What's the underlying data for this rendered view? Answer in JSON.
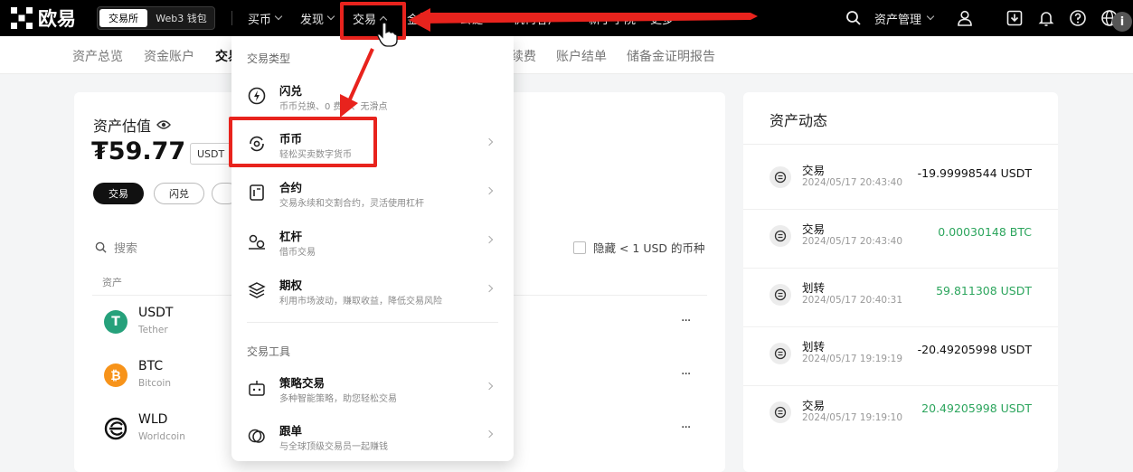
{
  "header": {
    "logo_text": "欧易",
    "tab_exchange": "交易所",
    "tab_web3": "Web3 钱包",
    "nav": [
      {
        "label": "买币"
      },
      {
        "label": "发现"
      },
      {
        "label": "交易"
      },
      {
        "label": "金融"
      },
      {
        "label": "公链"
      },
      {
        "label": "机构客户"
      },
      {
        "label": "新手学院"
      },
      {
        "label": "更多"
      }
    ],
    "asset_manage": "资产管理"
  },
  "subnav": {
    "items": [
      "资产总览",
      "资金账户",
      "交易账户",
      "续费",
      "账户结单",
      "储备金证明报告"
    ],
    "active_partial": "交易",
    "partial_visible": "续费"
  },
  "assets": {
    "valuation_title": "资产估值",
    "valuation_amount": "₮59.77",
    "currency": "USDT",
    "chips": [
      "交易",
      "闪兑"
    ],
    "search_placeholder": "搜索",
    "hide_small_label": "隐藏 < 1 USD 的币种",
    "column_asset": "资产",
    "rows": [
      {
        "symbol": "USDT",
        "name": "Tether",
        "more": "···"
      },
      {
        "symbol": "BTC",
        "name": "Bitcoin",
        "more": "···"
      },
      {
        "symbol": "WLD",
        "name": "Worldcoin",
        "more": "···"
      }
    ]
  },
  "activity": {
    "title": "资产动态",
    "rows": [
      {
        "type": "交易",
        "time": "2024/05/17 20:43:40",
        "amount": "-19.99998544 USDT",
        "positive": false
      },
      {
        "type": "交易",
        "time": "2024/05/17 20:43:40",
        "amount": "0.00030148 BTC",
        "positive": true
      },
      {
        "type": "划转",
        "time": "2024/05/17 20:40:31",
        "amount": "59.811308 USDT",
        "positive": true
      },
      {
        "type": "划转",
        "time": "2024/05/17 19:19:19",
        "amount": "-20.49205998 USDT",
        "positive": false
      },
      {
        "type": "交易",
        "time": "2024/05/17 19:19:10",
        "amount": "20.49205998 USDT",
        "positive": true
      }
    ]
  },
  "dropdown": {
    "section_types": "交易类型",
    "types": [
      {
        "title": "闪兑",
        "desc": "币币兑换、0 费率、无滑点",
        "icon": "flash-icon"
      },
      {
        "title": "币币",
        "desc": "轻松买卖数字货币",
        "icon": "spot-icon"
      },
      {
        "title": "合约",
        "desc": "交易永续和交割合约，灵活使用杠杆",
        "icon": "contract-icon"
      },
      {
        "title": "杠杆",
        "desc": "借币交易",
        "icon": "margin-icon"
      },
      {
        "title": "期权",
        "desc": "利用市场波动，赚取收益，降低交易风险",
        "icon": "options-icon"
      }
    ],
    "section_tools": "交易工具",
    "tools": [
      {
        "title": "策略交易",
        "desc": "多种智能策略，助您轻松交易",
        "icon": "bot-icon"
      },
      {
        "title": "跟单",
        "desc": "与全球顶级交易员一起赚钱",
        "icon": "copy-trade-icon"
      }
    ]
  },
  "colors": {
    "highlight": "#e8231d",
    "positive": "#2ca55d",
    "topbar": "#000000"
  }
}
